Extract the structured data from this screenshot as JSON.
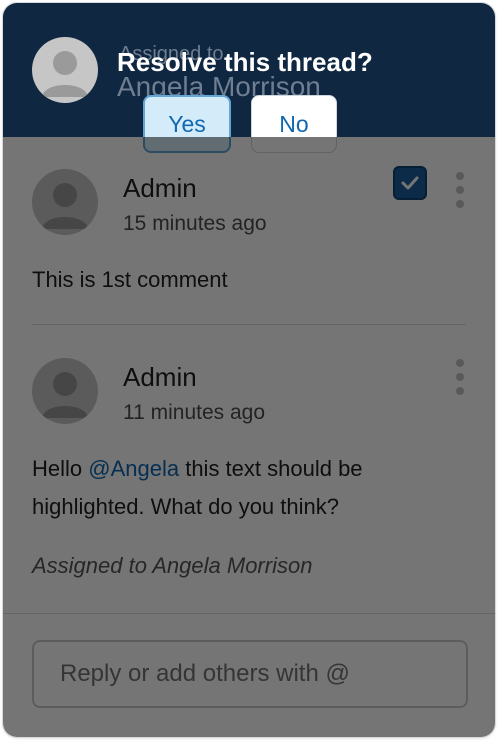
{
  "header": {
    "assigned_label": "Assigned to",
    "assigned_name": "Angela Morrison",
    "resolve_prompt": "Resolve this thread?",
    "yes_label": "Yes",
    "no_label": "No"
  },
  "comments": [
    {
      "author": "Admin",
      "time": "15 minutes ago",
      "text": "This is 1st comment",
      "resolved_checked": true
    },
    {
      "author": "Admin",
      "time": "11 minutes ago",
      "text_before": "Hello ",
      "mention": "@Angela",
      "text_after": " this text should be highlighted. What do you think?",
      "assigned_note": "Assigned to Angela Morrison"
    }
  ],
  "reply": {
    "placeholder": "Reply or add others with @"
  },
  "icons": {
    "avatar": "user-avatar-icon",
    "checkbox": "checkmark-icon",
    "more": "more-options-icon"
  },
  "colors": {
    "header_bg": "#0f2741",
    "accent": "#0f68b0",
    "checkbox": "#1c5f9e"
  }
}
